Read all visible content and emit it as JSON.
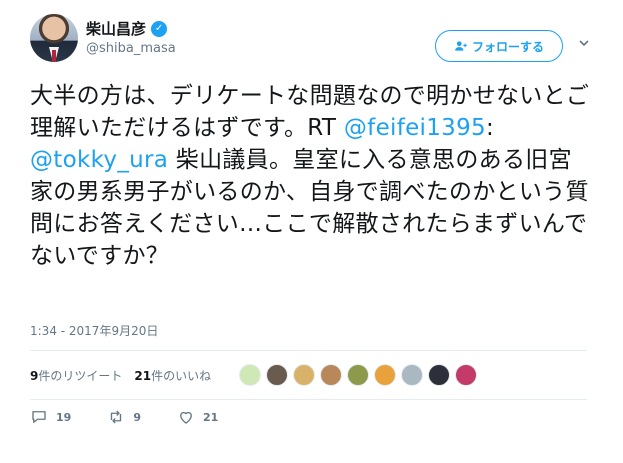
{
  "user": {
    "name": "柴山昌彦",
    "handle": "@shiba_masa",
    "verified_mark": "✓"
  },
  "follow_button": {
    "label": "フォローする"
  },
  "tweet": {
    "text_1": "大半の方は、デリケートな問題なので明かせないとご理解いただけるはずです。RT ",
    "mention_1": "@feifei1395",
    "sep": ": ",
    "mention_2": "@tokky_ura",
    "text_2": " 柴山議員。皇室に入る意思のある旧宮家の男系男子がいるのか、自身で調べたのかという質問にお答えください…ここで解散されたらまずいんでないですか？",
    "timestamp": "1:34 - 2017年9月20日"
  },
  "stats": {
    "retweets_count": "9",
    "retweets_label": "件のリツイート",
    "likes_count": "21",
    "likes_label": "件のいいね"
  },
  "likers": [
    {
      "name": "liker-1",
      "color": "#cfe8b5"
    },
    {
      "name": "liker-2",
      "color": "#6a5b4f"
    },
    {
      "name": "liker-3",
      "color": "#d9b26a"
    },
    {
      "name": "liker-4",
      "color": "#b8885a"
    },
    {
      "name": "liker-5",
      "color": "#8d9a4c"
    },
    {
      "name": "liker-6",
      "color": "#e9a23b"
    },
    {
      "name": "liker-7",
      "color": "#aab8c2"
    },
    {
      "name": "liker-8",
      "color": "#2d2f3a"
    },
    {
      "name": "liker-9",
      "color": "#c43b6a"
    }
  ],
  "actions": {
    "reply_count": "19",
    "retweet_count": "9",
    "like_count": "21"
  },
  "colors": {
    "accent": "#1da1f2",
    "text": "#14171a",
    "secondary": "#657786",
    "divider": "#e6ecf0"
  }
}
